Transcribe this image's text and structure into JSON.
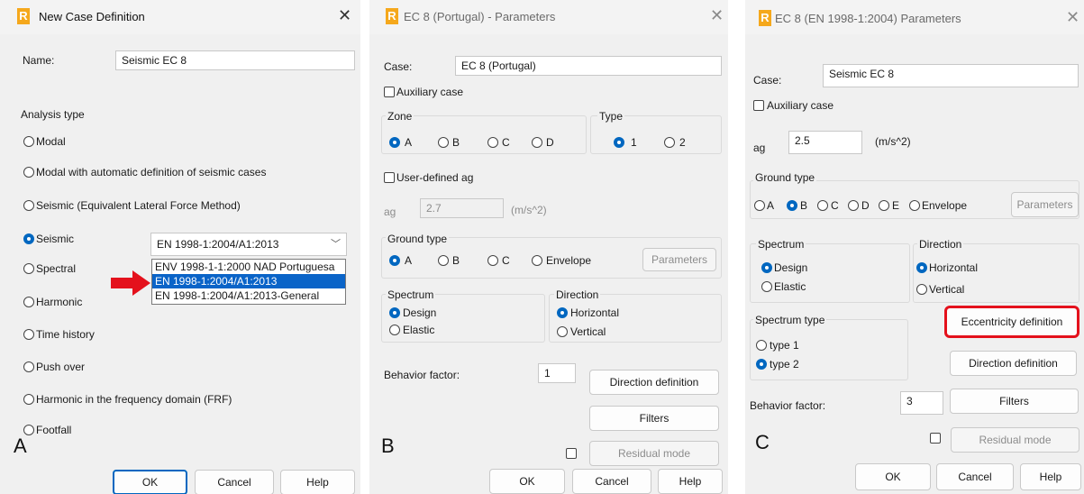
{
  "panelA": {
    "title": "New Case Definition",
    "name_label": "Name:",
    "name_value": "Seismic EC 8",
    "analysis_type_label": "Analysis type",
    "options": [
      "Modal",
      "Modal with automatic definition of seismic cases",
      "Seismic (Equivalent Lateral Force Method)",
      "Seismic",
      "Spectral",
      "Harmonic",
      "Time history",
      "Push over",
      "Harmonic in the frequency domain (FRF)",
      "Footfall"
    ],
    "selected_option": "Seismic",
    "norm_selected": "EN 1998-1:2004/A1:2013",
    "norm_list": [
      "ENV 1998-1-1:2000 NAD Portuguesa",
      "EN 1998-1:2004/A1:2013",
      "EN 1998-1:2004/A1:2013-General"
    ],
    "ok": "OK",
    "cancel": "Cancel",
    "help": "Help",
    "letter": "A",
    "arrow_color": "#e4111c"
  },
  "panelB": {
    "title": "EC 8 (Portugal) - Parameters",
    "case_label": "Case:",
    "case_value": "EC 8 (Portugal)",
    "aux_case": "Auxiliary case",
    "zone_label": "Zone",
    "zones": [
      "A",
      "B",
      "C",
      "D"
    ],
    "type_label": "Type",
    "types": [
      "1",
      "2"
    ],
    "user_ag": "User-defined ag",
    "ag_label": "ag",
    "ag_value": "2.7",
    "ag_unit": "(m/s^2)",
    "ground_type_label": "Ground type",
    "ground_types": [
      "A",
      "B",
      "C",
      "Envelope"
    ],
    "parameters": "Parameters",
    "spectrum_label": "Spectrum",
    "spectrum_opts": [
      "Design",
      "Elastic"
    ],
    "direction_label": "Direction",
    "direction_opts": [
      "Horizontal",
      "Vertical"
    ],
    "behavior_label": "Behavior factor:",
    "behavior_value": "1",
    "direction_def": "Direction definition",
    "filters": "Filters",
    "residual": "Residual mode",
    "ok": "OK",
    "cancel": "Cancel",
    "help": "Help",
    "letter": "B"
  },
  "panelC": {
    "title": "EC 8 (EN 1998-1:2004) Parameters",
    "case_label": "Case:",
    "case_value": "Seismic EC 8",
    "aux_case": "Auxiliary case",
    "ag_label": "ag",
    "ag_value": "2.5",
    "ag_unit": "(m/s^2)",
    "ground_type_label": "Ground type",
    "ground_types": [
      "A",
      "B",
      "C",
      "D",
      "E",
      "Envelope"
    ],
    "parameters": "Parameters",
    "spectrum_label": "Spectrum",
    "spectrum_opts": [
      "Design",
      "Elastic"
    ],
    "direction_label": "Direction",
    "direction_opts": [
      "Horizontal",
      "Vertical"
    ],
    "spectrum_type_label": "Spectrum type",
    "spectrum_types": [
      "type 1",
      "type 2"
    ],
    "eccentricity": "Eccentricity definition",
    "direction_def": "Direction definition",
    "behavior_label": "Behavior factor:",
    "behavior_value": "3",
    "filters": "Filters",
    "residual": "Residual mode",
    "ok": "OK",
    "cancel": "Cancel",
    "help": "Help",
    "letter": "C",
    "highlight_color": "#e4111c"
  },
  "colors": {
    "accent": "#0067c0",
    "selection": "#0a64c8",
    "dialog_bg": "#f0f0f0"
  }
}
